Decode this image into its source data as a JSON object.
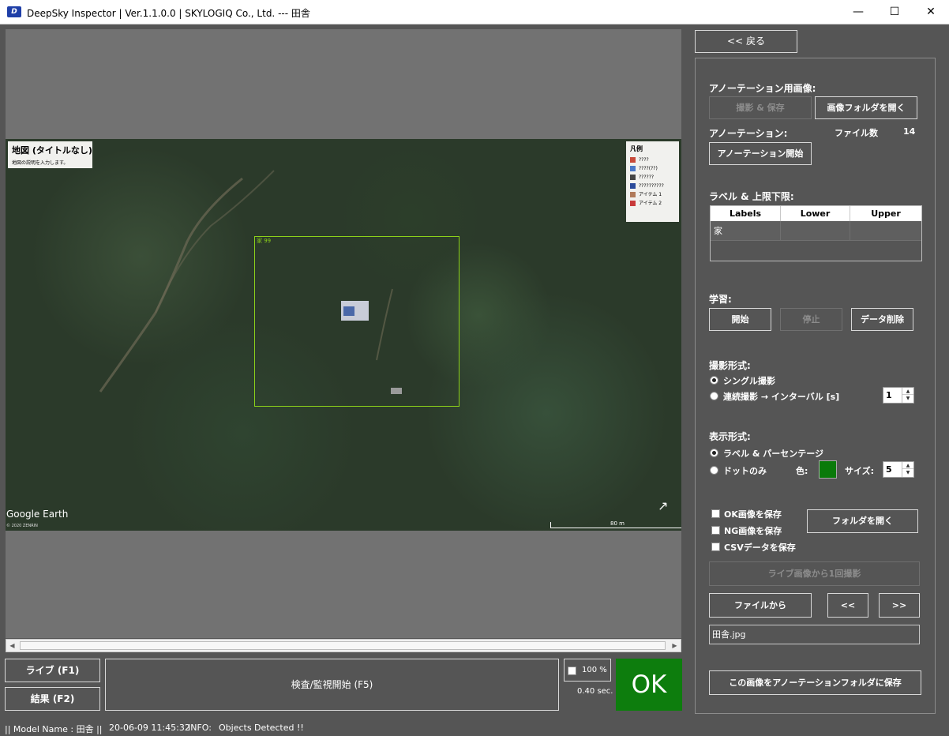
{
  "window": {
    "title": "DeepSky Inspector | Ver.1.1.0.0 | SKYLOGIQ Co., Ltd. --- 田舎",
    "icon_text": "D",
    "minimize": "—",
    "maximize": "☐",
    "close": "✕"
  },
  "image": {
    "map_title": "地図 (タイトルなし)",
    "map_description": "地図の説明を入力します。",
    "legend_title": "凡例",
    "legend_items": [
      "????",
      "????(??)",
      "??????",
      "??????????",
      "アイテム 1",
      "アイテム 2"
    ],
    "detection_label": "家 99",
    "watermark": "Google Earth",
    "copyright": "© 2020 ZENRIN",
    "scale": "80 m",
    "north_icon": "↗"
  },
  "scrollbar": {
    "left_arrow": "◀",
    "right_arrow": "▶"
  },
  "bottom": {
    "live_button": "ライブ (F1)",
    "result_button": "結果 (F2)",
    "inspect_button": "検査/監視開始 (F5)",
    "zoom_label": "100 %",
    "elapsed": "0.40 sec.",
    "result": "OK",
    "result_color": "#0d7d0d"
  },
  "status": {
    "model": "|| Model Name : 田舎 ||",
    "datetime": "20-06-09 11:45:32",
    "info_label": "INFO:",
    "info_message": "Objects Detected !!"
  },
  "panel": {
    "back_button": "<< 戻る",
    "annotation_image_label": "アノーテーション用画像:",
    "capture_save_button": "撮影 & 保存",
    "open_image_folder_button": "画像フォルダを開く",
    "annotation_label": "アノーテーション:",
    "file_count_label": "ファイル数",
    "file_count": "14",
    "start_annotation_button": "アノーテーション開始",
    "labels_limits_label": "ラベル & 上限下限:",
    "table": {
      "headers": [
        "Labels",
        "Lower",
        "Upper"
      ],
      "rows": [
        [
          "家",
          "",
          ""
        ]
      ]
    },
    "learning_label": "学習:",
    "learn_start_button": "開始",
    "learn_stop_button": "停止",
    "delete_data_button": "データ削除",
    "capture_mode_label": "撮影形式:",
    "single_capture": "シングル撮影",
    "continuous_capture": "連続撮影 → インターバル [s]",
    "interval_value": "1",
    "display_mode_label": "表示形式:",
    "label_percentage": "ラベル & パーセンテージ",
    "dot_only": "ドットのみ",
    "color_label": "色:",
    "dot_color": "#0a7a0a",
    "size_label": "サイズ:",
    "size_value": "5",
    "save_ok_images": "OK画像を保存",
    "save_ng_images": "NG画像を保存",
    "save_csv": "CSVデータを保存",
    "open_folder_button": "フォルダを開く",
    "capture_once_button": "ライブ画像から1回撮影",
    "from_file_button": "ファイルから",
    "prev_button": "<<",
    "next_button": ">>",
    "file_name": "田舎.jpg",
    "save_to_annotation_button": "この画像をアノーテーションフォルダに保存",
    "spin_up": "▲",
    "spin_down": "▼"
  }
}
